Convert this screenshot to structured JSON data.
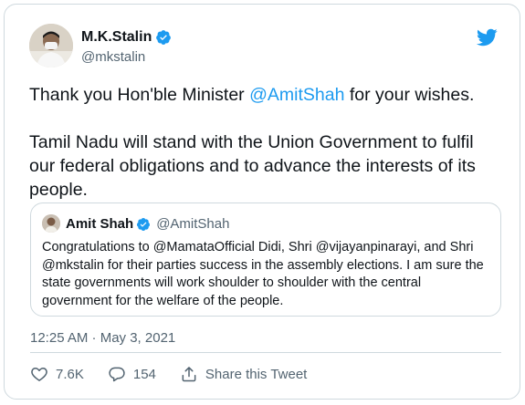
{
  "author": {
    "name": "M.K.Stalin",
    "handle": "@mkstalin"
  },
  "tweet": {
    "text_line1_before": "Thank you Hon'ble Minister ",
    "text_line1_mention": "@AmitShah",
    "text_line1_after": " for your wishes.",
    "text_para2": "Tamil Nadu will stand with the Union Government to fulfil our federal obligations and to advance the interests of its people."
  },
  "quoted": {
    "name": "Amit Shah",
    "handle": "@AmitShah",
    "text": "Congratulations to @MamataOfficial Didi, Shri @vijayanpinarayi, and Shri @mkstalin for their parties success in the assembly elections. I am sure the state governments will work shoulder to shoulder with the central government for the welfare of the people."
  },
  "timestamp": "12:25 AM · May 3, 2021",
  "actions": {
    "likes": "7.6K",
    "replies": "154",
    "share_label": "Share this Tweet"
  },
  "colors": {
    "accent": "#1d9bf0",
    "secondary_text": "#536471",
    "border": "#cfd9de"
  },
  "icons": [
    "verified-badge-icon",
    "twitter-bird-icon",
    "heart-icon",
    "reply-bubble-icon",
    "share-icon"
  ]
}
